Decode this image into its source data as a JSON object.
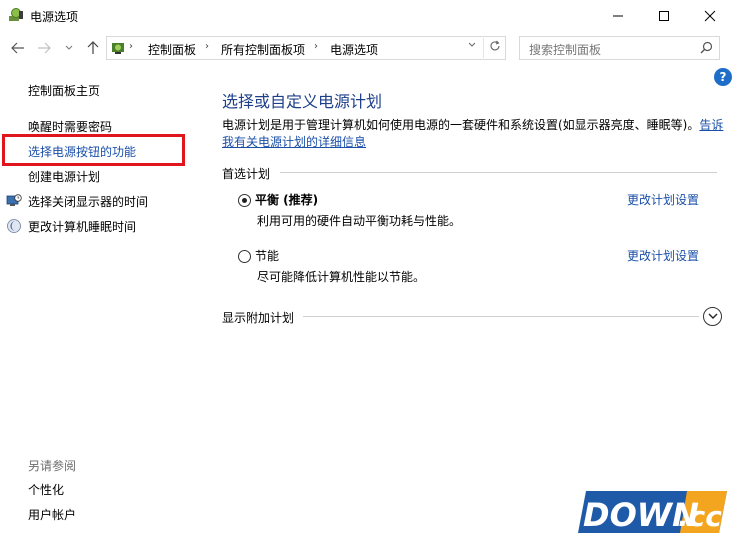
{
  "window": {
    "title": "电源选项",
    "controls": {
      "minimize": "—",
      "maximize": "☐",
      "close": "✕"
    }
  },
  "address_bar": {
    "breadcrumbs": [
      "控制面板",
      "所有控制面板项",
      "电源选项"
    ],
    "search_placeholder": "搜索控制面板"
  },
  "sidebar": {
    "home": "控制面板主页",
    "links": [
      {
        "label": "唤醒时需要密码",
        "icon": ""
      },
      {
        "label": "选择电源按钮的功能",
        "icon": ""
      },
      {
        "label": "创建电源计划",
        "icon": ""
      },
      {
        "label": "选择关闭显示器的时间",
        "icon": "monitor-clock-icon"
      },
      {
        "label": "更改计算机睡眠时间",
        "icon": "moon-icon"
      }
    ],
    "see_also": {
      "title": "另请参阅",
      "links": [
        "个性化",
        "用户帐户"
      ]
    }
  },
  "main": {
    "title": "选择或自定义电源计划",
    "description": "电源计划是用于管理计算机如何使用电源的一套硬件和系统设置(如显示器亮度、睡眠等)。",
    "description_link": "告诉我有关电源计划的详细信息",
    "preferred_section": "首选计划",
    "plans": [
      {
        "name": "平衡 (推荐)",
        "description": "利用可用的硬件自动平衡功耗与性能。",
        "selected": true,
        "change_label": "更改计划设置"
      },
      {
        "name": "节能",
        "description": "尽可能降低计算机性能以节能。",
        "selected": false,
        "change_label": "更改计划设置"
      }
    ],
    "more_section": "显示附加计划",
    "help_label": "?"
  },
  "watermark": {
    "text_main": "DOWN",
    "text_suffix": ".cc"
  },
  "colors": {
    "link": "#1a4fa8",
    "title": "#1e3f8a",
    "highlight": "#e0161c"
  }
}
